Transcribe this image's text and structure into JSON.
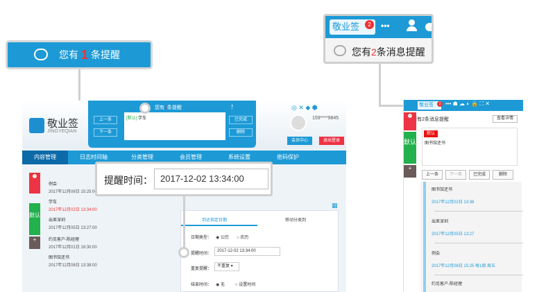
{
  "callout_reminder": {
    "text_prefix": "您有",
    "count": "1",
    "text_suffix": "条提醒"
  },
  "callout_message": {
    "logo": "敬业签",
    "badge": "2",
    "dots": "•••",
    "text_prefix": "您有",
    "count": "2",
    "text_suffix": "条消息提醒"
  },
  "callout_time": {
    "label": "提醒时间：",
    "value": "2017-12-02 13:34:00"
  },
  "main_app": {
    "logo_title": "敬业签",
    "logo_sub": "JINGYEQIAN",
    "phone": "159****9845",
    "nav": [
      "内容管理",
      "日志时间轴",
      "分类管理",
      "会员管理",
      "系统设置",
      "密码保护"
    ],
    "notif_title_prefix": "您有",
    "notif_count": "1",
    "notif_title_suffix": "条提醒",
    "notif_prev": "上一条",
    "notif_next": "下一条",
    "notif_done": "已完成",
    "notif_delete": "删除",
    "notif_content_tag": "[默认]",
    "notif_content": "学车",
    "member_center": "会员中心",
    "logout": "退出登录",
    "side_tags": [
      "默认"
    ],
    "list": [
      {
        "title": "例会",
        "date": "2017年12月08日 15:25:00"
      },
      {
        "title": "学车",
        "date": "2017年12月02日 13:34:00"
      },
      {
        "title": "出差深圳",
        "date": "2017年12月05日 13:27:00"
      },
      {
        "title": "约见客户-陈经理",
        "date": "2017年12月01日 16:30:00"
      },
      {
        "title": "图书馆还书",
        "date": "2017年12月08日 13:38:00"
      }
    ],
    "form_tabs": [
      "到达指定日期",
      "移动分类到"
    ],
    "form_date_type_label": "日期类型：",
    "form_date_type_opts": [
      "公历",
      "农历"
    ],
    "form_remind_label": "提醒时间：",
    "form_remind_value": "2017-12-02 13:34:00",
    "form_repeat_label": "重复提醒：",
    "form_repeat_value": "不重复",
    "form_end_label": "结束时间：",
    "form_end_opts": [
      "无",
      "设置时间"
    ]
  },
  "right_panel": {
    "logo": "敬业签",
    "badge": "2",
    "msg": "您有2条消息提醒",
    "detail_btn": "查看详情",
    "tag_red": "默认",
    "content": "图书馆还书",
    "side_tag": "默认",
    "buttons": [
      "上一条",
      "下一条",
      "已完成",
      "删除"
    ],
    "list": [
      {
        "title": "图书馆还书",
        "date": "2017年12月02日 13:38"
      },
      {
        "title": "出差深圳",
        "date": "2017年12月05日 13:27"
      },
      {
        "title": "例会",
        "date": "2017年12月08日 15:25 每1周 周五"
      },
      {
        "title": "约见客户-陈经理",
        "date": ""
      }
    ]
  },
  "colors": {
    "accent": "#1d9ad6",
    "red": "#e33333",
    "green": "#22b14c"
  }
}
